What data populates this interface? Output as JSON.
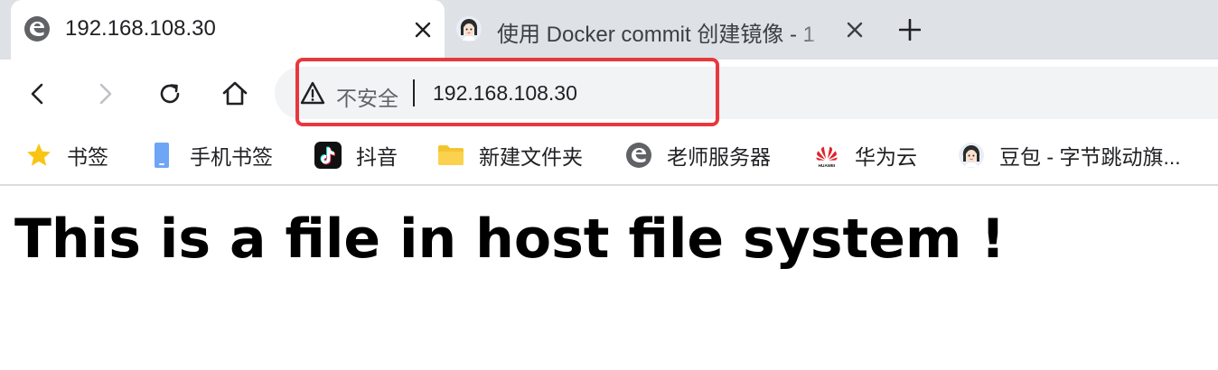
{
  "tabs": [
    {
      "title": "192.168.108.30",
      "icon": "edge-logo-icon",
      "active": true
    },
    {
      "title": "使用 Docker commit 创建镜像 - 1",
      "icon": "avatar-girl-icon",
      "active": false
    }
  ],
  "toolbar": {
    "security_label": "不安全",
    "url": "192.168.108.30"
  },
  "bookmarks": [
    {
      "label": "书签",
      "icon": "star-icon"
    },
    {
      "label": "手机书签",
      "icon": "phone-icon"
    },
    {
      "label": "抖音",
      "icon": "tiktok-icon"
    },
    {
      "label": "新建文件夹",
      "icon": "folder-icon"
    },
    {
      "label": "老师服务器",
      "icon": "edge-logo-icon"
    },
    {
      "label": "华为云",
      "icon": "huawei-logo-icon",
      "logo_text": "HUAWEI"
    },
    {
      "label": "豆包 - 字节跳动旗...",
      "icon": "avatar-girl-icon"
    }
  ],
  "page": {
    "heading": "This is a file in host file system !"
  },
  "colors": {
    "tabstrip": "#dee1e6",
    "omnibox": "#f1f3f4",
    "highlight": "#e8383d",
    "star": "#f9c513",
    "folder": "#f4c430",
    "phone": "#6ea6f5"
  }
}
